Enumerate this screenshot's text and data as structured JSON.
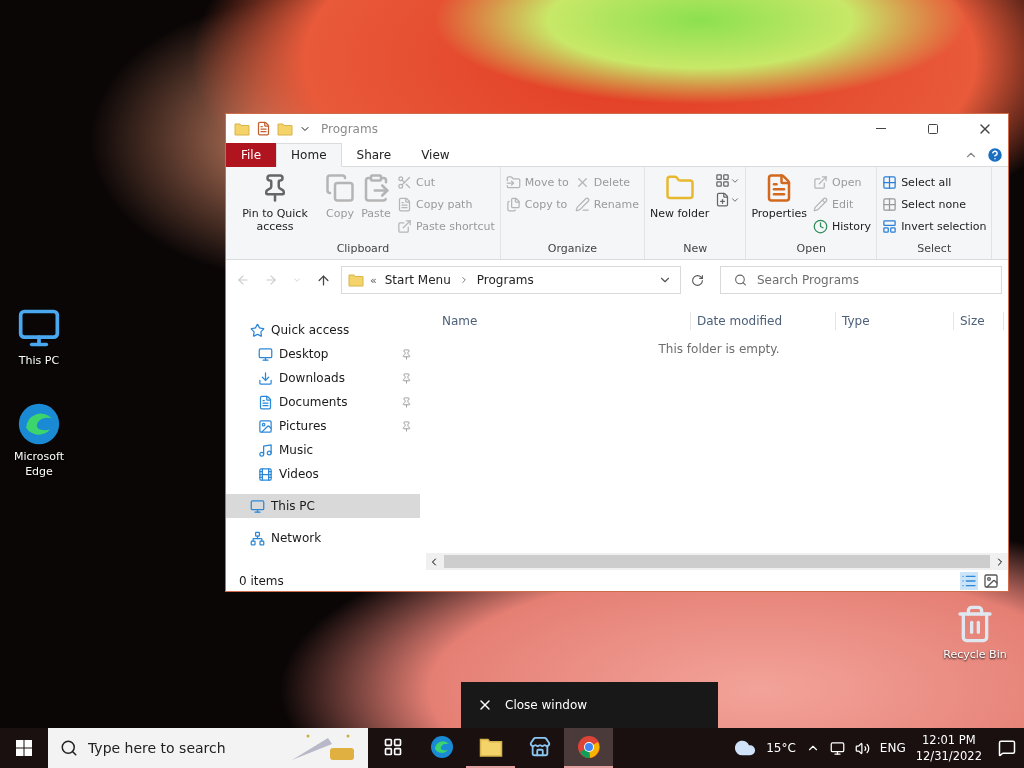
{
  "desktop_icons": [
    {
      "label": "This PC"
    },
    {
      "label": "Microsoft Edge"
    },
    {
      "label": "Recycle Bin"
    }
  ],
  "window": {
    "title": "Programs",
    "tabs": [
      {
        "label": "File",
        "kind": "file",
        "selected": false
      },
      {
        "label": "Home",
        "kind": "tab",
        "selected": true
      },
      {
        "label": "Share",
        "kind": "tab",
        "selected": false
      },
      {
        "label": "View",
        "kind": "tab",
        "selected": false
      }
    ],
    "ribbon_groups": [
      {
        "label": "Clipboard",
        "commands": [
          {
            "label": "Pin to Quick access",
            "kind": "large",
            "disabled": false
          },
          {
            "label": "Copy",
            "kind": "large",
            "disabled": true
          },
          {
            "label": "Paste",
            "kind": "large",
            "disabled": true
          },
          {
            "label": "Cut",
            "kind": "small",
            "disabled": true
          },
          {
            "label": "Copy path",
            "kind": "small",
            "disabled": true
          },
          {
            "label": "Paste shortcut",
            "kind": "small",
            "disabled": true
          }
        ]
      },
      {
        "label": "Organize",
        "commands": [
          {
            "label": "Move to",
            "kind": "small",
            "disabled": true
          },
          {
            "label": "Copy to",
            "kind": "small",
            "disabled": true
          },
          {
            "label": "Delete",
            "kind": "small",
            "disabled": true
          },
          {
            "label": "Rename",
            "kind": "small",
            "disabled": true
          }
        ]
      },
      {
        "label": "New",
        "commands": [
          {
            "label": "New folder",
            "kind": "large",
            "disabled": false
          },
          {
            "kind": "icon",
            "disabled": false
          },
          {
            "kind": "icon",
            "disabled": false
          }
        ]
      },
      {
        "label": "Open",
        "commands": [
          {
            "label": "Properties",
            "kind": "large",
            "disabled": false
          },
          {
            "label": "Open",
            "kind": "small",
            "disabled": true
          },
          {
            "label": "Edit",
            "kind": "small",
            "disabled": true
          },
          {
            "label": "History",
            "kind": "small",
            "disabled": false
          }
        ]
      },
      {
        "label": "Select",
        "commands": [
          {
            "label": "Select all",
            "kind": "small",
            "disabled": false
          },
          {
            "label": "Select none",
            "kind": "small",
            "disabled": false
          },
          {
            "label": "Invert selection",
            "kind": "small",
            "disabled": false
          }
        ]
      }
    ],
    "address": {
      "overflow": "«",
      "segments": [
        "Start Menu",
        "Programs"
      ]
    },
    "search": {
      "placeholder": "Search Programs"
    },
    "nav": [
      {
        "label": "Quick access",
        "selected": false,
        "children": [
          {
            "label": "Desktop",
            "pinned": true,
            "selected": false
          },
          {
            "label": "Downloads",
            "pinned": true,
            "selected": false
          },
          {
            "label": "Documents",
            "pinned": true,
            "selected": false
          },
          {
            "label": "Pictures",
            "pinned": true,
            "selected": false
          },
          {
            "label": "Music",
            "pinned": false,
            "selected": false
          },
          {
            "label": "Videos",
            "pinned": false,
            "selected": false
          }
        ]
      },
      {
        "label": "This PC",
        "selected": true
      },
      {
        "label": "Network",
        "selected": false
      }
    ],
    "columns": [
      "Name",
      "Date modified",
      "Type",
      "Size"
    ],
    "empty_message": "This folder is empty.",
    "status": "0 items"
  },
  "tooltip": {
    "label": "Close window"
  },
  "taskbar": {
    "search_placeholder": "Type here to search",
    "apps": [
      {
        "running": false,
        "selected": false
      },
      {
        "running": false,
        "selected": false
      },
      {
        "running": true,
        "selected": false
      },
      {
        "running": false,
        "selected": false
      },
      {
        "running": true,
        "selected": true
      }
    ],
    "temperature": "15°C",
    "language": "ENG",
    "time": "12:01 PM",
    "date": "12/31/2022"
  }
}
